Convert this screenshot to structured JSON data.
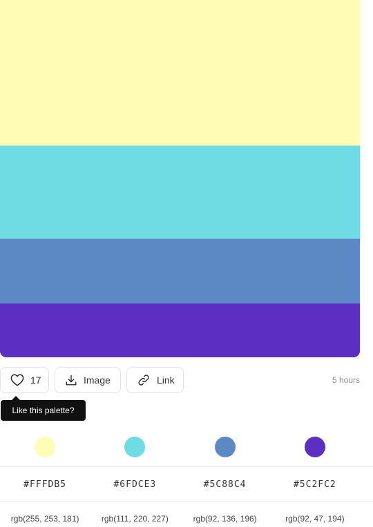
{
  "palette": {
    "colors": [
      "#FFFDB5",
      "#6FDCE3",
      "#5C88C4",
      "#5C2FC2"
    ]
  },
  "actions": {
    "like_count": "17",
    "image_label": "Image",
    "link_label": "Link",
    "time": "5 hours"
  },
  "tooltip": {
    "text": "Like this palette?"
  },
  "swatches": [
    {
      "color": "#FFFDB5",
      "hex": "#FFFDB5",
      "rgb": "rgb(255, 253, 181)"
    },
    {
      "color": "#6FDCE3",
      "hex": "#6FDCE3",
      "rgb": "rgb(111, 220, 227)"
    },
    {
      "color": "#5C88C4",
      "hex": "#5C88C4",
      "rgb": "rgb(92, 136, 196)"
    },
    {
      "color": "#5C2FC2",
      "hex": "#5C2FC2",
      "rgb": "rgb(92, 47, 194)"
    }
  ]
}
